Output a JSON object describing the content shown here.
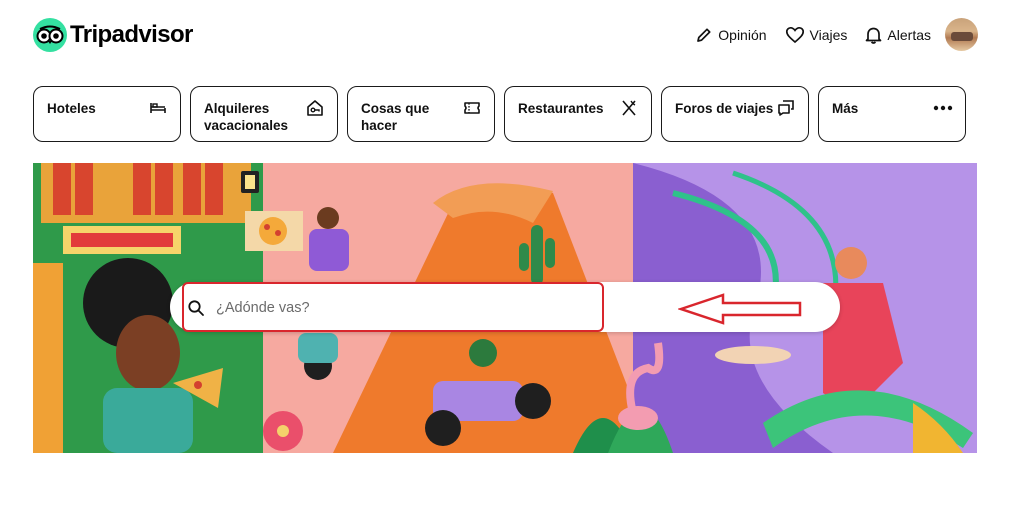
{
  "brand": {
    "name": "Tripadvisor",
    "accent": "#34e0a1"
  },
  "nav": {
    "review": "Opinión",
    "trips": "Viajes",
    "alerts": "Alertas"
  },
  "categories": [
    {
      "label": "Hoteles",
      "icon": "bed-icon"
    },
    {
      "label": "Alquileres vacacionales",
      "icon": "house-key-icon"
    },
    {
      "label": "Cosas que hacer",
      "icon": "ticket-icon"
    },
    {
      "label": "Restaurantes",
      "icon": "cutlery-icon"
    },
    {
      "label": "Foros de viajes",
      "icon": "chat-bubbles-icon"
    },
    {
      "label": "Más",
      "icon": "more-dots-icon"
    }
  ],
  "search": {
    "placeholder": "¿Adónde vas?",
    "value": ""
  },
  "annotation": {
    "color": "#d9262d"
  }
}
